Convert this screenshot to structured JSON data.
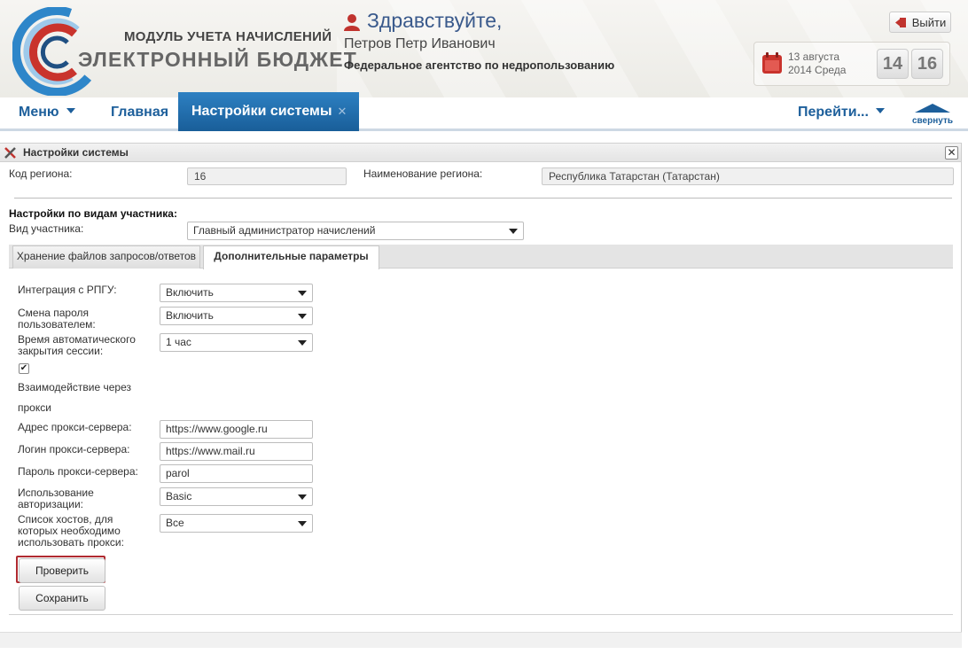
{
  "header": {
    "system_subtitle": "МОДУЛЬ УЧЕТА НАЧИСЛЕНИЙ",
    "system_title": "ЭЛЕКТРОННЫЙ БЮДЖЕТ",
    "greeting": "Здравствуйте,",
    "user_name": "Петров Петр Иванович",
    "agency": "Федеральное агентство по недропользованию",
    "logout_label": "Выйти",
    "date_line1": "13 августа",
    "date_line2": "2014 Среда",
    "clock_hours": "14",
    "clock_minutes": "16"
  },
  "nav": {
    "menu_label": "Меню",
    "home_label": "Главная",
    "active_tab_label": "Настройки системы",
    "goto_label": "Перейти...",
    "collapse_label": "свернуть"
  },
  "panel": {
    "title": "Настройки системы",
    "region_code_label": "Код региона:",
    "region_code_value": "16",
    "region_name_label": "Наименование региона:",
    "region_name_value": "Республика Татарстан (Татарстан)",
    "participant_settings_heading": "Настройки по видам участника:",
    "participant_type_label": "Вид участника:",
    "participant_type_value": "Главный администратор начислений",
    "tabs": [
      {
        "label": "Хранение файлов запросов/ответов"
      },
      {
        "label": "Дополнительные параметры"
      }
    ],
    "form": {
      "rpgu_label": "Интеграция с РПГУ:",
      "rpgu_value": "Включить",
      "pwd_change_label_1": "Смена пароля",
      "pwd_change_label_2": "пользователем:",
      "pwd_change_value": "Включить",
      "session_label_1": "Время автоматического",
      "session_label_2": "закрытия сессии:",
      "session_value": "1 час",
      "proxy_checkbox_checked": true,
      "proxy_label_1": "Взаимодействие через",
      "proxy_label_2": "прокси",
      "proxy_address_label": "Адрес прокси-сервера:",
      "proxy_address_value": "https://www.google.ru",
      "proxy_login_label": "Логин прокси-сервера:",
      "proxy_login_value": "https://www.mail.ru",
      "proxy_password_label": "Пароль прокси-сервера:",
      "proxy_password_value": "parol",
      "auth_label_1": "Использование",
      "auth_label_2": "авторизации:",
      "auth_value": "Basic",
      "hosts_label_1": "Список хостов, для",
      "hosts_label_2": "которых необходимо",
      "hosts_label_3": "использовать прокси:",
      "hosts_value": "Все",
      "check_button": "Проверить",
      "save_button": "Сохранить"
    }
  },
  "colors": {
    "accent_blue": "#1d5f9b",
    "active_tab": "#2d80c2",
    "highlight_red": "#b02a30",
    "icon_red": "#c0332e"
  }
}
